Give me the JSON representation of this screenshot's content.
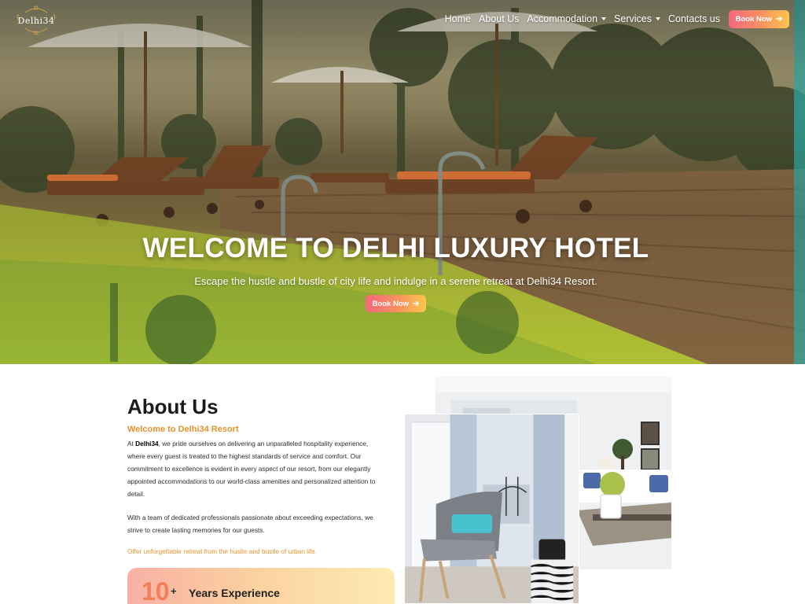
{
  "brand": {
    "logo_text": "Delhi34"
  },
  "nav": {
    "items": [
      {
        "label": "Home",
        "dropdown": false
      },
      {
        "label": "About Us",
        "dropdown": false
      },
      {
        "label": "Accommodation",
        "dropdown": true
      },
      {
        "label": "Services",
        "dropdown": true
      },
      {
        "label": "Contacts us",
        "dropdown": false
      }
    ],
    "book_label": "Book Now"
  },
  "hero": {
    "title": "WELCOME TO DELHI LUXURY HOTEL",
    "subtitle": "Escape the hustle and bustle of city life and indulge in a serene retreat at Delhi34 Resort.",
    "book_label": "Book Now"
  },
  "about": {
    "title": "About Us",
    "subtitle": "Welcome to Delhi34 Resort",
    "brand_bold": "Delhi34",
    "p1_pre": "At ",
    "p1_post": ", we pride ourselves on delivering an unparalleled hospitality experience, where every guest is treated to the highest standards of service and comfort. Our commitment to excellence is evident in every aspect of our resort, from our elegantly appointed accommodations to our world-class amenities and personalized attention to detail.",
    "p2": "With a team of dedicated professionals passionate about exceeding expectations, we strive to create lasting memories for our guests.",
    "tagline": "Offer unforgettable retreat from the hustle and bustle of urban life.",
    "experience": {
      "number": "10",
      "plus": "+",
      "label": "Years Experience"
    }
  },
  "colors": {
    "accent_orange": "#e8912c",
    "button_gradient_start": "#f5677e",
    "button_gradient_end": "#fbc54d"
  },
  "icons": {
    "book_arrow": "arrow-right-icon",
    "dropdown": "caret-down-icon"
  }
}
